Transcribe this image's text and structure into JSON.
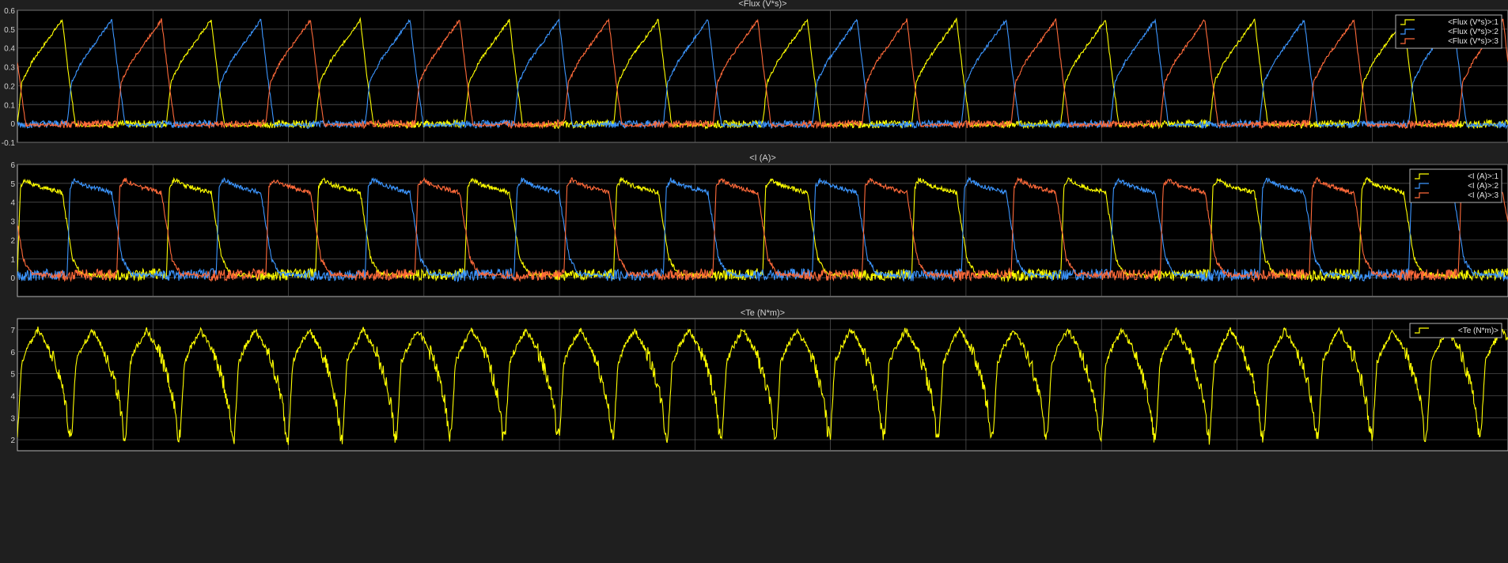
{
  "colors": {
    "background": "#1f1f1f",
    "axes": "#000000",
    "frame": "#b4b4b4",
    "grid": "#5a5a5a",
    "text": "#d2d2d2",
    "yellow": "#ffff00",
    "blue": "#3c96ff",
    "orange": "#ff6a3a"
  },
  "chart_data": [
    {
      "type": "line",
      "title": "<Flux (V*s)>",
      "xlabel": "",
      "ylabel": "",
      "ylim": [
        -0.1,
        0.6
      ],
      "yticks": [
        "-0.1",
        "0",
        "0.1",
        "0.2",
        "0.3",
        "0.4",
        "0.5",
        "0.6"
      ],
      "ytick_values": [
        -0.1,
        0,
        0.1,
        0.2,
        0.3,
        0.4,
        0.5,
        0.6
      ],
      "grid": true,
      "legend_position": "top-right",
      "cycles": 10,
      "series": [
        {
          "name": "<Flux (V*s)>:1",
          "color": "yellow",
          "phase_offset": 0.0,
          "waveform": {
            "base": 0.0,
            "peak": 0.55,
            "noise": 0.008,
            "shape_t": [
              0,
              0.03,
              0.1,
              0.3,
              0.345,
              0.39,
              1.0
            ],
            "shape_v": [
              0.0,
              0.22,
              0.33,
              0.55,
              0.25,
              -0.01,
              0.0
            ]
          }
        },
        {
          "name": "<Flux (V*s)>:2",
          "color": "blue",
          "phase_offset": 0.3333,
          "waveform": {
            "base": 0.0,
            "peak": 0.55,
            "noise": 0.008,
            "shape_t": [
              0,
              0.03,
              0.1,
              0.3,
              0.345,
              0.39,
              1.0
            ],
            "shape_v": [
              0.0,
              0.22,
              0.33,
              0.55,
              0.25,
              -0.01,
              0.0
            ]
          }
        },
        {
          "name": "<Flux (V*s)>:3",
          "color": "orange",
          "phase_offset": 0.6667,
          "waveform": {
            "base": 0.0,
            "peak": 0.55,
            "noise": 0.008,
            "shape_t": [
              0,
              0.03,
              0.1,
              0.3,
              0.345,
              0.39,
              1.0
            ],
            "shape_v": [
              0.0,
              0.22,
              0.33,
              0.55,
              0.25,
              -0.01,
              0.0
            ]
          }
        }
      ]
    },
    {
      "type": "line",
      "title": "<I (A)>",
      "xlabel": "",
      "ylabel": "",
      "ylim": [
        -1,
        6
      ],
      "yticks": [
        "0",
        "1",
        "2",
        "3",
        "4",
        "5",
        "6"
      ],
      "ytick_values": [
        0,
        1,
        2,
        3,
        4,
        5,
        6
      ],
      "grid": true,
      "legend_position": "top-right",
      "cycles": 10,
      "series": [
        {
          "name": "<I (A)>:1",
          "color": "yellow",
          "phase_offset": 0.0,
          "waveform": {
            "base": 0.1,
            "peak": 5.2,
            "noise": 0.12,
            "shape_t": [
              0,
              0.02,
              0.05,
              0.12,
              0.3,
              0.33,
              0.37,
              0.43,
              0.6,
              1.0
            ],
            "shape_v": [
              0.2,
              4.8,
              5.2,
              4.9,
              4.5,
              3.0,
              1.0,
              0.2,
              0.1,
              0.2
            ]
          }
        },
        {
          "name": "<I (A)>:2",
          "color": "blue",
          "phase_offset": 0.3333,
          "waveform": {
            "base": 0.1,
            "peak": 5.2,
            "noise": 0.12,
            "shape_t": [
              0,
              0.02,
              0.05,
              0.12,
              0.3,
              0.33,
              0.37,
              0.43,
              0.6,
              1.0
            ],
            "shape_v": [
              0.2,
              4.8,
              5.2,
              4.9,
              4.5,
              3.0,
              1.0,
              0.2,
              0.1,
              0.2
            ]
          }
        },
        {
          "name": "<I (A)>:3",
          "color": "orange",
          "phase_offset": 0.6667,
          "waveform": {
            "base": 0.1,
            "peak": 5.2,
            "noise": 0.12,
            "shape_t": [
              0,
              0.02,
              0.05,
              0.12,
              0.3,
              0.33,
              0.37,
              0.43,
              0.6,
              1.0
            ],
            "shape_v": [
              0.2,
              4.8,
              5.2,
              4.9,
              4.5,
              3.0,
              1.0,
              0.2,
              0.1,
              0.2
            ]
          }
        }
      ]
    },
    {
      "type": "line",
      "title": "<Te (N*m)>",
      "xlabel": "",
      "ylabel": "",
      "ylim": [
        1.5,
        7.5
      ],
      "yticks": [
        "2",
        "3",
        "4",
        "5",
        "6",
        "7"
      ],
      "ytick_values": [
        2,
        3,
        4,
        5,
        6,
        7
      ],
      "grid": true,
      "legend_position": "top-right",
      "cycles": 27.5,
      "series": [
        {
          "name": "<Te (N*m)>",
          "color": "yellow",
          "phase_offset": 0.0,
          "waveform": {
            "base": 2.0,
            "peak": 7.0,
            "noise": 0.15,
            "shape_t": [
              0,
              0.08,
              0.2,
              0.38,
              0.5,
              0.65,
              0.8,
              0.9,
              0.95,
              1.0
            ],
            "shape_v": [
              2.1,
              5.5,
              6.2,
              7.0,
              6.5,
              5.8,
              4.6,
              3.5,
              2.3,
              2.1
            ]
          }
        }
      ]
    }
  ]
}
